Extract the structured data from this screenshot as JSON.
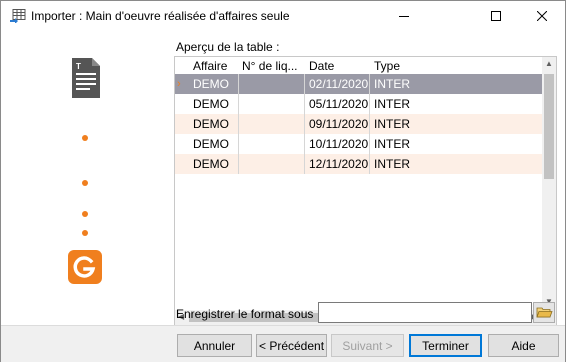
{
  "window": {
    "title": "Importer : Main d'oeuvre réalisée d'affaires seule"
  },
  "sidebar": {
    "doc_icon": "document-icon",
    "steps": [
      "step-dot",
      "step-dot",
      "step-dot",
      "step-dot"
    ],
    "logo_icon": "g-logo-icon",
    "accent": "#f07f1e"
  },
  "grid": {
    "caption": "Aperçu de la table :",
    "columns": [
      "Affaire",
      "N° de liq...",
      "Date",
      "Type"
    ],
    "rows": [
      [
        "DEMO",
        "",
        "02/11/2020",
        "INTER"
      ],
      [
        "DEMO",
        "",
        "05/11/2020",
        "INTER"
      ],
      [
        "DEMO",
        "",
        "09/11/2020",
        "INTER"
      ],
      [
        "DEMO",
        "",
        "10/11/2020",
        "INTER"
      ],
      [
        "DEMO",
        "",
        "12/11/2020",
        "INTER"
      ]
    ],
    "selected_color": "#9a9aa6",
    "alt_color": "#fdefe6"
  },
  "save_format": {
    "label": "Enregistrer le format sous",
    "value": ""
  },
  "buttons": {
    "cancel": "Annuler",
    "previous": "< Précédent",
    "next": "Suivant >",
    "finish": "Terminer",
    "help": "Aide"
  }
}
